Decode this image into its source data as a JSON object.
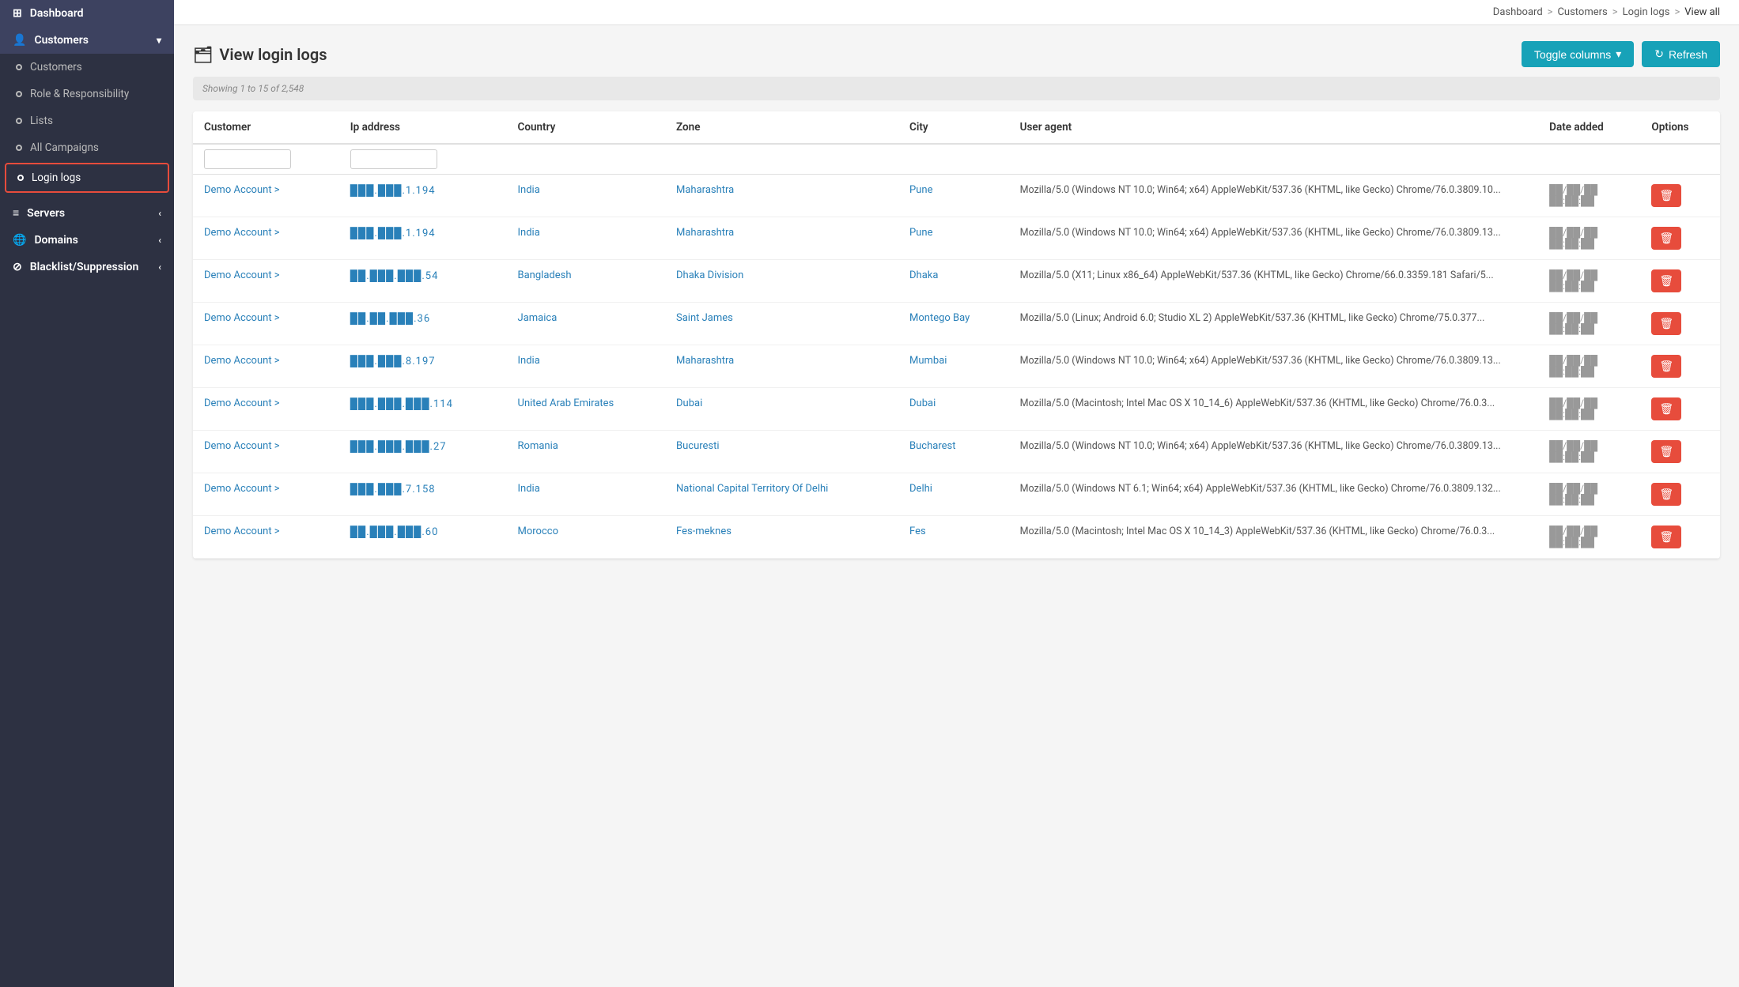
{
  "sidebar": {
    "logo": "Dashboard",
    "items": [
      {
        "id": "dashboard",
        "label": "Dashboard",
        "icon": "⊞",
        "type": "parent",
        "active": false
      },
      {
        "id": "customers",
        "label": "Customers",
        "icon": "👤",
        "type": "parent",
        "active": true,
        "expanded": true
      },
      {
        "id": "customers-sub",
        "label": "Customers",
        "icon": "circle",
        "type": "sub",
        "active": false
      },
      {
        "id": "role-responsibility",
        "label": "Role & Responsibility",
        "icon": "circle",
        "type": "sub",
        "active": false
      },
      {
        "id": "lists",
        "label": "Lists",
        "icon": "circle",
        "type": "sub",
        "active": false
      },
      {
        "id": "all-campaigns",
        "label": "All Campaigns",
        "icon": "circle",
        "type": "sub",
        "active": false
      },
      {
        "id": "login-logs",
        "label": "Login logs",
        "icon": "circle",
        "type": "sub",
        "active": true,
        "outlined": true
      },
      {
        "id": "servers",
        "label": "Servers",
        "icon": "≡",
        "type": "parent",
        "active": false,
        "arrow": "‹"
      },
      {
        "id": "domains",
        "label": "Domains",
        "icon": "🌐",
        "type": "parent",
        "active": false,
        "arrow": "‹"
      },
      {
        "id": "blacklist",
        "label": "Blacklist/Suppression",
        "icon": "⊘",
        "type": "parent",
        "active": false,
        "arrow": "‹"
      }
    ]
  },
  "breadcrumb": {
    "items": [
      "Dashboard",
      "Customers",
      "Login logs",
      "View all"
    ],
    "separators": [
      ">",
      ">",
      ">"
    ]
  },
  "page": {
    "title": "View login logs",
    "title_icon": "🗂",
    "toggle_columns_label": "Toggle columns",
    "refresh_label": "Refresh",
    "filter_label": "Showing 1 to 15 of 2,548"
  },
  "table": {
    "columns": [
      "Customer",
      "Ip address",
      "Country",
      "Zone",
      "City",
      "User agent",
      "Date added",
      "Options"
    ],
    "rows": [
      {
        "customer": "Demo Account",
        "customer_arrow": ">",
        "ip": "███.███.1.194",
        "country": "India",
        "zone": "Maharashtra",
        "city": "Pune",
        "user_agent": "Mozilla/5.0 (Windows NT 10.0; Win64; x64) AppleWebKit/537.36 (KHTML, like Gecko) Chrome/76.0.3809.10...",
        "date1": "██/██/██",
        "date2": "██:██:██"
      },
      {
        "customer": "Demo Account",
        "customer_arrow": ">",
        "ip": "███.███.1.194",
        "country": "India",
        "zone": "Maharashtra",
        "city": "Pune",
        "user_agent": "Mozilla/5.0 (Windows NT 10.0; Win64; x64) AppleWebKit/537.36 (KHTML, like Gecko) Chrome/76.0.3809.13...",
        "date1": "██/██/██",
        "date2": "██:██:██"
      },
      {
        "customer": "Demo Account",
        "customer_arrow": ">",
        "ip": "██.███.███.54",
        "country": "Bangladesh",
        "zone": "Dhaka Division",
        "city": "Dhaka",
        "user_agent": "Mozilla/5.0 (X11; Linux x86_64) AppleWebKit/537.36 (KHTML, like Gecko) Chrome/66.0.3359.181 Safari/5...",
        "date1": "██/██/██",
        "date2": "██:██:██"
      },
      {
        "customer": "Demo Account",
        "customer_arrow": ">",
        "ip": "██.██.███.36",
        "country": "Jamaica",
        "zone": "Saint James",
        "city": "Montego Bay",
        "user_agent": "Mozilla/5.0 (Linux; Android 6.0; Studio XL 2) AppleWebKit/537.36 (KHTML, like Gecko) Chrome/75.0.377...",
        "date1": "██/██/██",
        "date2": "██:██:██"
      },
      {
        "customer": "Demo Account",
        "customer_arrow": ">",
        "ip": "███.███.8.197",
        "country": "India",
        "zone": "Maharashtra",
        "city": "Mumbai",
        "user_agent": "Mozilla/5.0 (Windows NT 10.0; Win64; x64) AppleWebKit/537.36 (KHTML, like Gecko) Chrome/76.0.3809.13...",
        "date1": "██/██/██",
        "date2": "██:██:██"
      },
      {
        "customer": "Demo Account",
        "customer_arrow": ">",
        "ip": "███.███.███.114",
        "country": "United Arab Emirates",
        "zone": "Dubai",
        "city": "Dubai",
        "user_agent": "Mozilla/5.0 (Macintosh; Intel Mac OS X 10_14_6) AppleWebKit/537.36 (KHTML, like Gecko) Chrome/76.0.3...",
        "date1": "██/██/██",
        "date2": "██:██:██"
      },
      {
        "customer": "Demo Account",
        "customer_arrow": ">",
        "ip": "███.███.███.27",
        "country": "Romania",
        "zone": "Bucuresti",
        "city": "Bucharest",
        "user_agent": "Mozilla/5.0 (Windows NT 10.0; Win64; x64) AppleWebKit/537.36 (KHTML, like Gecko) Chrome/76.0.3809.13...",
        "date1": "██/██/██",
        "date2": "██:██:██"
      },
      {
        "customer": "Demo Account",
        "customer_arrow": ">",
        "ip": "███.███.7.158",
        "country": "India",
        "zone": "National Capital Territory Of Delhi",
        "city": "Delhi",
        "user_agent": "Mozilla/5.0 (Windows NT 6.1; Win64; x64) AppleWebKit/537.36 (KHTML, like Gecko) Chrome/76.0.3809.132...",
        "date1": "██/██/██",
        "date2": "██:██:██"
      },
      {
        "customer": "Demo Account",
        "customer_arrow": ">",
        "ip": "██.███.███.60",
        "country": "Morocco",
        "zone": "Fes-meknes",
        "city": "Fes",
        "user_agent": "Mozilla/5.0 (Macintosh; Intel Mac OS X 10_14_3) AppleWebKit/537.36 (KHTML, like Gecko) Chrome/76.0.3...",
        "date1": "██/██/██",
        "date2": "██:██:██"
      }
    ]
  },
  "icons": {
    "dashboard": "⊞",
    "customers": "👤",
    "servers": "≡",
    "domains": "🌐",
    "blacklist": "⊘",
    "refresh": "↻",
    "toggle": "▼",
    "trash": "🗑",
    "table_icon": "🗂"
  }
}
